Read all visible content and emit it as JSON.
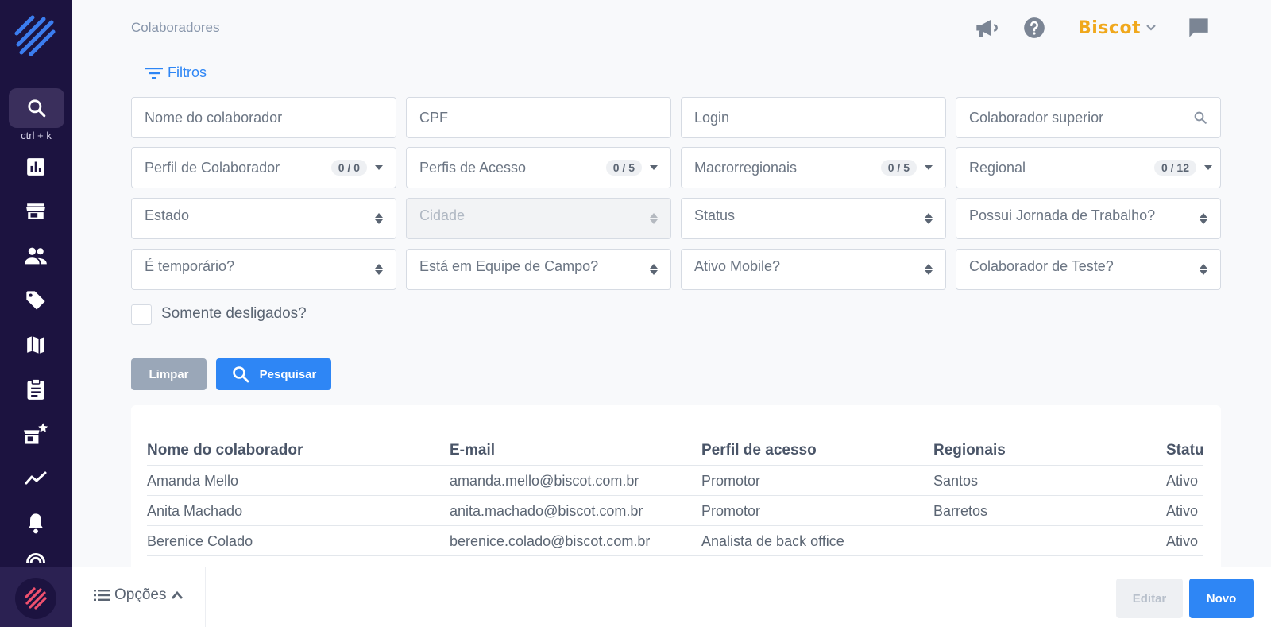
{
  "sidebar": {
    "shortcut": "ctrl + k",
    "items": [
      {
        "icon": "chart-bar-icon"
      },
      {
        "icon": "store-icon"
      },
      {
        "icon": "users-icon"
      },
      {
        "icon": "tag-icon"
      },
      {
        "icon": "map-icon"
      },
      {
        "icon": "clipboard-icon"
      },
      {
        "icon": "store-star-icon"
      },
      {
        "icon": "trend-line-icon"
      },
      {
        "icon": "bell-icon"
      },
      {
        "icon": "broadcast-icon"
      }
    ]
  },
  "header": {
    "title": "Colaboradores",
    "brand": "Biscot",
    "brand_color": "#f0a81c",
    "accent": "#2e86f5"
  },
  "filters": {
    "label": "Filtros",
    "nome": "Nome do colaborador",
    "cpf": "CPF",
    "login": "Login",
    "superior": "Colaborador superior",
    "perfil_colab": "Perfil de Colaborador",
    "perfil_colab_count": "0 / 0",
    "perfis_acesso": "Perfis de Acesso",
    "perfis_acesso_count": "0 / 5",
    "macro": "Macrorregionais",
    "macro_count": "0 / 5",
    "regional": "Regional",
    "regional_count": "0 / 12",
    "estado": "Estado",
    "cidade": "Cidade",
    "status": "Status",
    "jornada": "Possui Jornada de Trabalho?",
    "temporario": "É temporário?",
    "equipe_campo": "Está em Equipe de Campo?",
    "ativo_mobile": "Ativo Mobile?",
    "teste": "Colaborador de Teste?",
    "desligados": "Somente desligados?",
    "clear": "Limpar",
    "search": "Pesquisar"
  },
  "table": {
    "headers": [
      "Nome do colaborador",
      "E-mail",
      "Perfil de acesso",
      "Regionais",
      "Status"
    ],
    "rows": [
      [
        "Amanda Mello",
        "amanda.mello@biscot.com.br",
        "Promotor",
        "Santos",
        "Ativo"
      ],
      [
        "Anita Machado",
        "anita.machado@biscot.com.br",
        "Promotor",
        "Barretos",
        "Ativo"
      ],
      [
        "Berenice Colado",
        "berenice.colado@biscot.com.br",
        "Analista de back office",
        "",
        "Ativo"
      ]
    ]
  },
  "footer": {
    "options": "Opções",
    "edit": "Editar",
    "new": "Novo"
  }
}
